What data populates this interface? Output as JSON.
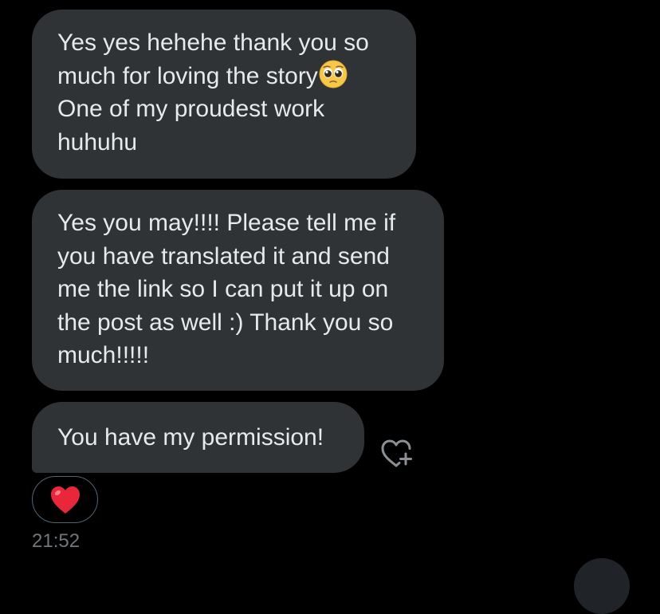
{
  "messages": [
    {
      "lines": [
        "Yes yes hehehe thank you so",
        "much for loving the story",
        "One of my proudest work",
        "huhuhu"
      ],
      "emoji": "pleading-face-emoji"
    },
    {
      "lines": [
        "Yes you may!!!! Please tell me if",
        "you have translated it and send",
        "me the link so I can put it up on",
        "the post as well :) Thank you so",
        "much!!!!!"
      ]
    },
    {
      "lines": [
        "You have my permission!"
      ]
    }
  ],
  "reaction": {
    "emoji": "red-heart-emoji"
  },
  "timestamp": "21:52",
  "icons": {
    "add_reaction": "heart-plus-icon"
  },
  "colors": {
    "background": "#000000",
    "bubble": "#2f3336",
    "text": "#e7e9ea",
    "muted": "#71767b",
    "heart": "#e0245e"
  }
}
